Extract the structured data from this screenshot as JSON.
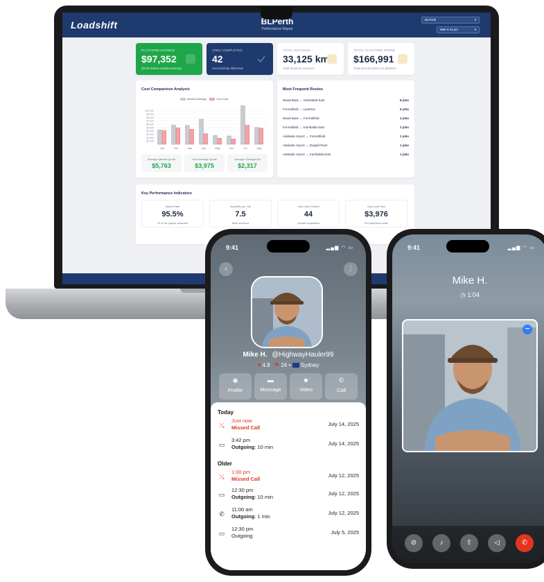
{
  "dashboard": {
    "logo": "Loadshift",
    "title": "BLPerth",
    "subtitle": "Performance Report",
    "account_select": "BLPerth",
    "date_select": "date 6-11 jun",
    "kpis": [
      {
        "label": "PLATFORM SAVINGS",
        "value": "$97,352",
        "sub": "36.8% below market average"
      },
      {
        "label": "JOBS COMPLETED",
        "value": "42",
        "sub": "Successfully delivered"
      },
      {
        "label": "TOTAL DISTANCE",
        "value": "33,125 km",
        "sub": "Total distance covered"
      },
      {
        "label": "TOTAL PLATFORM SPEND",
        "value": "$166,991",
        "sub": "Total amount spent on platform"
      }
    ],
    "cost_section_title": "Cost Comparison Analysis",
    "routes_section_title": "Most Frequent Routes",
    "routes": [
      {
        "route": "Naval Base → Kambalda East",
        "jobs": "8 jobs"
      },
      {
        "route": "Forrestfield → Laverton",
        "jobs": "5 jobs"
      },
      {
        "route": "Naval Base → Forrestfield",
        "jobs": "4 jobs"
      },
      {
        "route": "Forrestfield → Kambalda East",
        "jobs": "2 jobs"
      },
      {
        "route": "Adelaide Airport → Forrestfield",
        "jobs": "1 jobs"
      },
      {
        "route": "Adelaide Airport → Dugald River",
        "jobs": "1 jobs"
      },
      {
        "route": "Adelaide Airport → Kambalda East",
        "jobs": "1 jobs"
      }
    ],
    "cost_summary": [
      {
        "label": "Average Market Quote",
        "value": "$5,763"
      },
      {
        "label": "Your Average Quote",
        "value": "$3,975"
      },
      {
        "label": "Average Savings/Job",
        "value": "$2,317"
      }
    ],
    "kpi_section_title": "Key Performance Indicators",
    "kpi_cards": [
      {
        "label": "Award Rate",
        "value": "95.5%",
        "sub": "42 of 44 quotes awarded"
      },
      {
        "label": "Avg Bids per Job",
        "value": "7.5",
        "sub": "Bids received"
      },
      {
        "label": "Total Jobs Posted",
        "value": "44",
        "sub": "Quotes requested"
      },
      {
        "label": "Avg Load Size",
        "value": "$3,976",
        "sub": "Per shipment value"
      }
    ]
  },
  "chart_data": {
    "type": "bar",
    "categories": [
      "Jan",
      "Feb",
      "Mar",
      "Apr",
      "May",
      "Jun",
      "Jul",
      "Aug"
    ],
    "series": [
      {
        "name": "Market Average",
        "values": [
          4300,
          5700,
          5600,
          7500,
          2600,
          2500,
          11500,
          5000
        ],
        "color": "#c9cbd0"
      },
      {
        "name": "Your Cost",
        "values": [
          4100,
          4900,
          4500,
          3200,
          1800,
          1600,
          5700,
          4800
        ],
        "color": "#f3a3a7"
      }
    ],
    "y_ticks": [
      "$10,000",
      "$9,000",
      "$8,000",
      "$7,000",
      "$6,000",
      "$5,000",
      "$4,000",
      "$3,000",
      "$2,000",
      "$1,000"
    ],
    "ylim": [
      0,
      12000
    ],
    "legend": "top"
  },
  "contact_phone": {
    "time": "9:41",
    "name": "Mike H.",
    "handle": "@HighwayHauler99",
    "rating": "4.8",
    "count": "24",
    "location": "Sydney",
    "actions": [
      {
        "icon": "profile-icon",
        "label": "Profile"
      },
      {
        "icon": "message-icon",
        "label": "Message"
      },
      {
        "icon": "video-icon",
        "label": "Video"
      },
      {
        "icon": "call-icon",
        "label": "Call"
      }
    ],
    "groups": {
      "today": "Today",
      "older": "Older"
    },
    "calls": [
      {
        "time": "Just now",
        "kind": "Missed Call",
        "duration": "",
        "date": "July 14, 2025",
        "missed": true,
        "icon": "missed-call-icon"
      },
      {
        "time": "3:42 pm",
        "kind": "Outgoing",
        "duration": ": 10 min",
        "date": "July 14, 2025",
        "missed": false,
        "icon": "video-call-icon"
      },
      {
        "time": "1:00 pm",
        "kind": "Missed Call",
        "duration": "",
        "date": "July 12, 2025",
        "missed": true,
        "icon": "missed-call-icon"
      },
      {
        "time": "12:30 pm",
        "kind": "Outgoing",
        "duration": ": 10 min",
        "date": "July 12, 2025",
        "missed": false,
        "icon": "video-call-icon"
      },
      {
        "time": "11:00 am",
        "kind": "Outgoing",
        "duration": ": 1 min",
        "date": "July 12, 2025",
        "missed": false,
        "icon": "phone-outgoing-icon"
      },
      {
        "time": "12:30 pm",
        "kind": "Outgoing",
        "duration": "",
        "date": "July 5, 2025",
        "missed": false,
        "icon": "video-call-icon"
      }
    ]
  },
  "call_phone": {
    "time": "9:41",
    "name": "Mike H.",
    "duration": "1:04",
    "controls": [
      "camera-off-icon",
      "microphone-icon",
      "share-screen-icon",
      "speaker-icon",
      "end-call-icon"
    ]
  }
}
